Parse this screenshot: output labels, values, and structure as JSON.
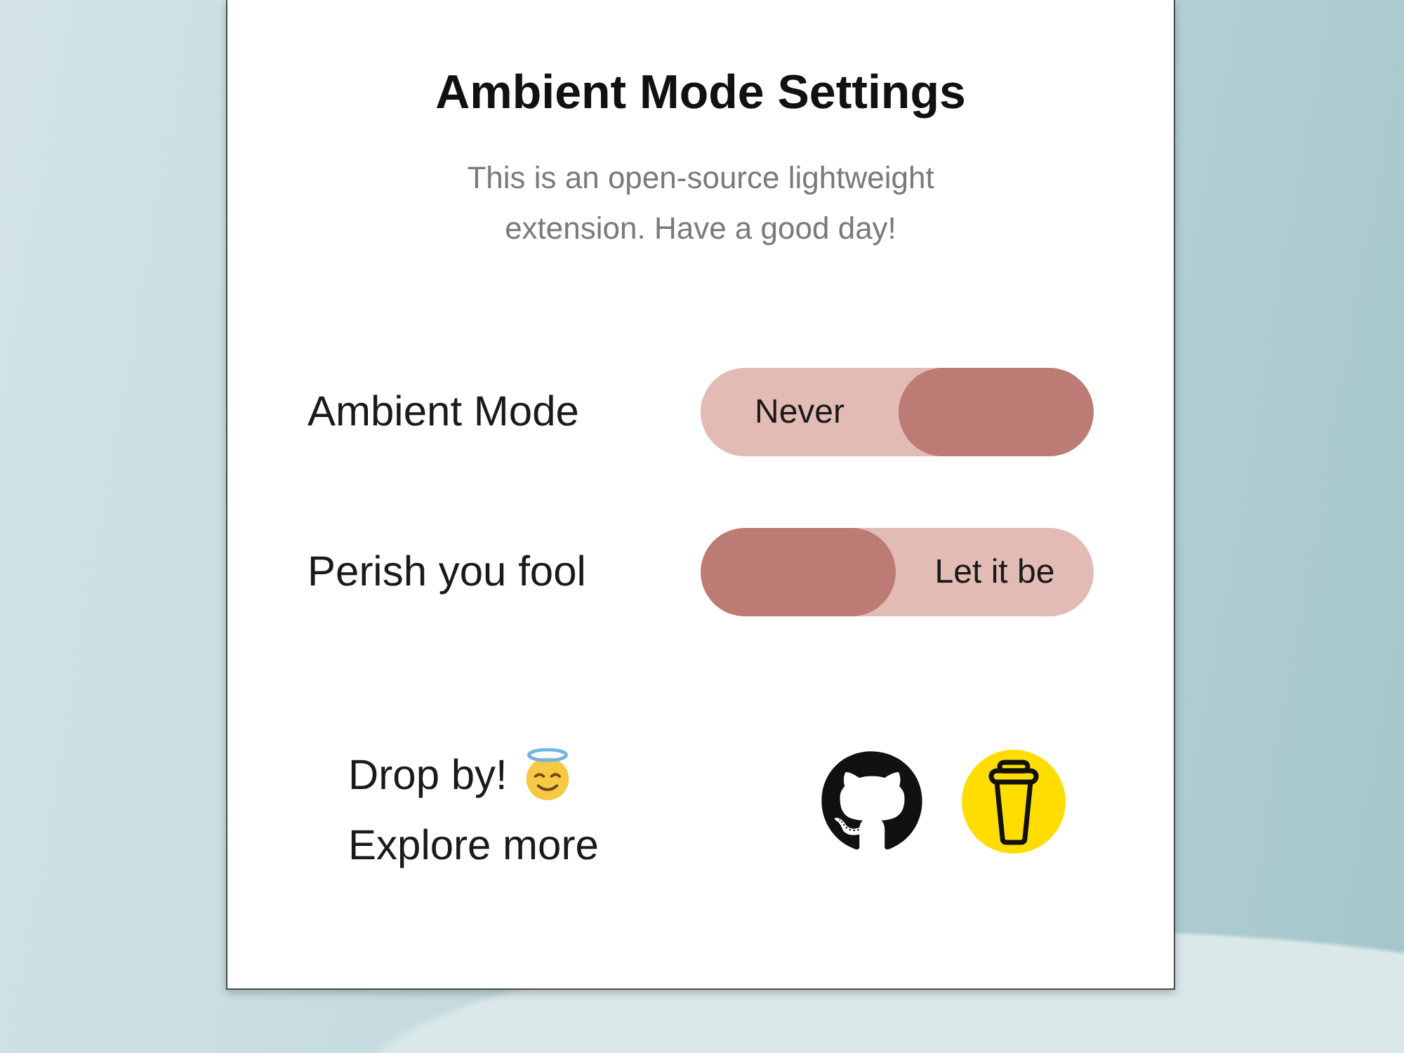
{
  "panel": {
    "title": "Ambient Mode Settings",
    "description": "This is an open-source lightweight extension. Have a good day!"
  },
  "settings": [
    {
      "label": "Ambient Mode",
      "option": "Never",
      "checked": true
    },
    {
      "label": "Perish you fool",
      "option": "Let it be",
      "checked": false
    }
  ],
  "footer": {
    "lines": [
      "Drop by!",
      "Explore more"
    ]
  }
}
